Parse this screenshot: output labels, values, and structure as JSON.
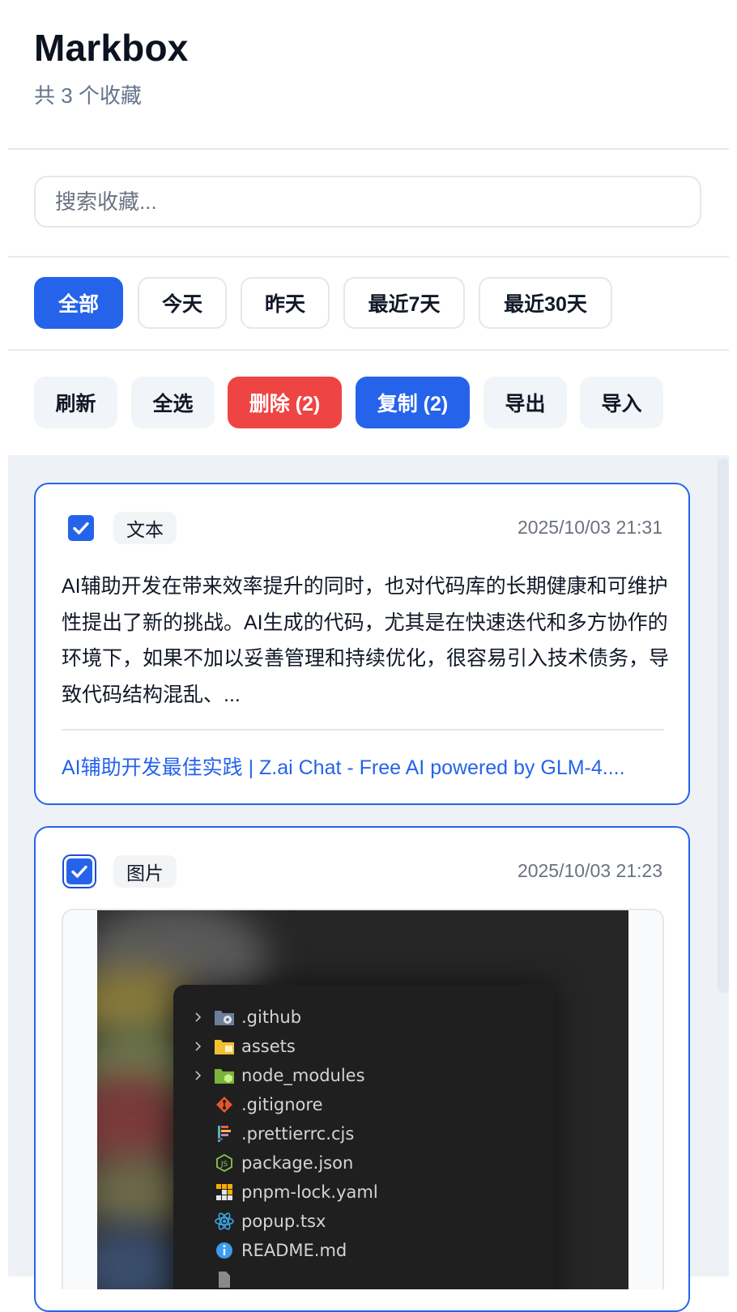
{
  "app": {
    "title": "Markbox",
    "subtitle": "共 3 个收藏"
  },
  "search": {
    "placeholder": "搜索收藏...",
    "value": ""
  },
  "filters": [
    {
      "label": "全部",
      "active": true
    },
    {
      "label": "今天",
      "active": false
    },
    {
      "label": "昨天",
      "active": false
    },
    {
      "label": "最近7天",
      "active": false
    },
    {
      "label": "最近30天",
      "active": false
    }
  ],
  "actions": {
    "refresh": "刷新",
    "select_all": "全选",
    "delete": "删除 (2)",
    "copy": "复制 (2)",
    "export": "导出",
    "import": "导入"
  },
  "items": [
    {
      "type": "文本",
      "checked": true,
      "timestamp": "2025/10/03 21:31",
      "text": "AI辅助开发在带来效率提升的同时，也对代码库的长期健康和可维护性提出了新的挑战。AI生成的代码，尤其是在快速迭代和多方协作的环境下，如果不加以妥善管理和持续优化，很容易引入技术债务，导致代码结构混乱、...",
      "source": "AI辅助开发最佳实践 | Z.ai Chat - Free AI powered by GLM-4...."
    },
    {
      "type": "图片",
      "checked": true,
      "timestamp": "2025/10/03 21:23",
      "image_files": [
        {
          "name": ".github",
          "icon": "folder-github-icon",
          "expandable": true
        },
        {
          "name": "assets",
          "icon": "folder-assets-icon",
          "expandable": true
        },
        {
          "name": "node_modules",
          "icon": "folder-node-icon",
          "expandable": true
        },
        {
          "name": ".gitignore",
          "icon": "git-icon",
          "expandable": false
        },
        {
          "name": ".prettierrc.cjs",
          "icon": "prettier-icon",
          "expandable": false
        },
        {
          "name": "package.json",
          "icon": "nodejs-icon",
          "expandable": false
        },
        {
          "name": "pnpm-lock.yaml",
          "icon": "pnpm-icon",
          "expandable": false
        },
        {
          "name": "popup.tsx",
          "icon": "react-icon",
          "expandable": false
        },
        {
          "name": "README.md",
          "icon": "info-icon",
          "expandable": false
        }
      ]
    }
  ],
  "colors": {
    "accent": "#2563eb",
    "danger": "#ef4444",
    "muted_text": "#64748b",
    "list_background": "#eef2f7"
  }
}
